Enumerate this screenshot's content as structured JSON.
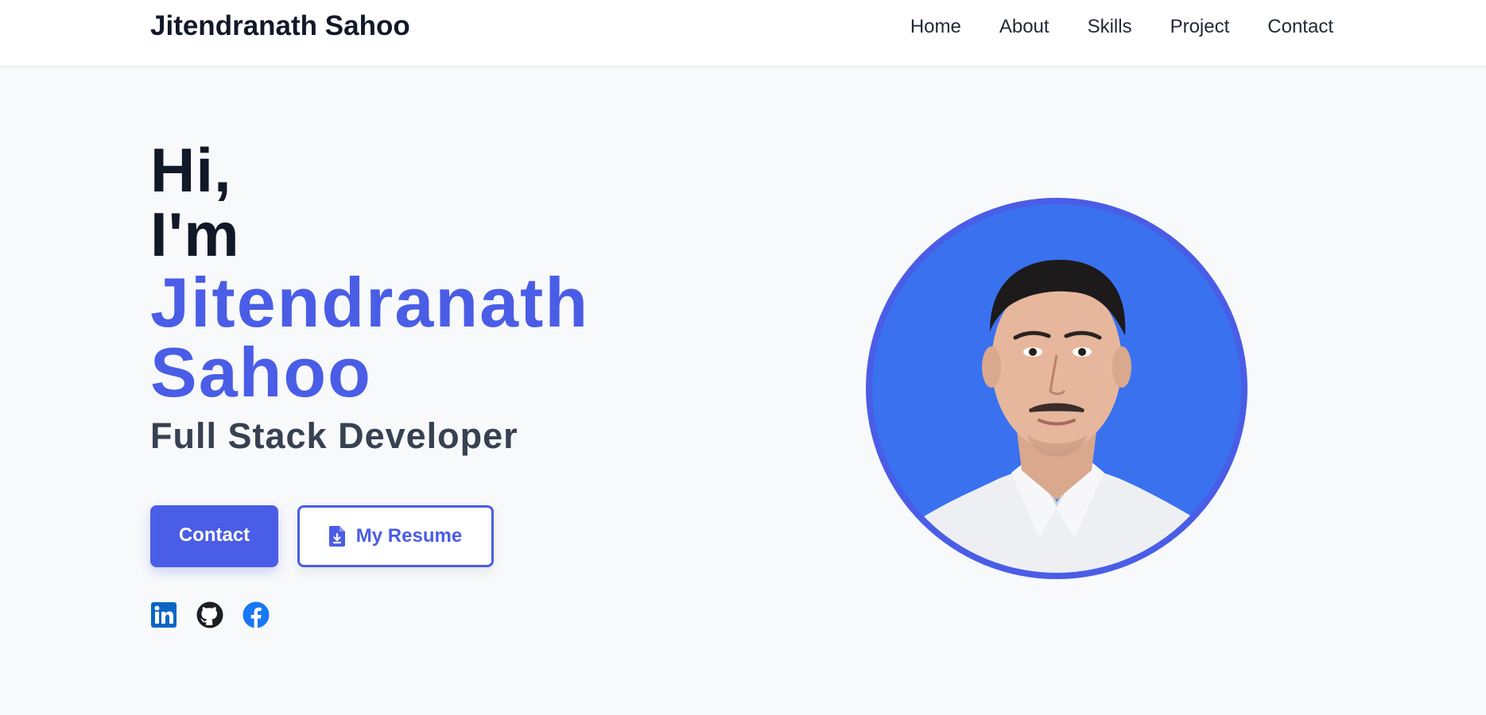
{
  "navbar": {
    "brand": "Jitendranath Sahoo",
    "links": [
      "Home",
      "About",
      "Skills",
      "Project",
      "Contact"
    ]
  },
  "hero": {
    "greeting_line1": "Hi,",
    "greeting_line2": "I'm",
    "name_line1": "Jitendranath",
    "name_line2": "Sahoo",
    "role": "Full Stack Developer",
    "contact_button": "Contact",
    "resume_button": "My Resume",
    "resume_icon": "file-download-icon"
  },
  "socials": [
    {
      "icon": "linkedin-icon",
      "color": "#0a66c2"
    },
    {
      "icon": "github-icon",
      "color": "#1b1f24"
    },
    {
      "icon": "facebook-icon",
      "color": "#1877f2"
    }
  ],
  "avatar": {
    "icon": "profile-photo",
    "ring_color": "#4a5de6",
    "background_color": "#3a71ef"
  },
  "colors": {
    "accent": "#4a5de6",
    "heading": "#111827",
    "subheading": "#374151",
    "page_background": "#f8f9fb"
  }
}
